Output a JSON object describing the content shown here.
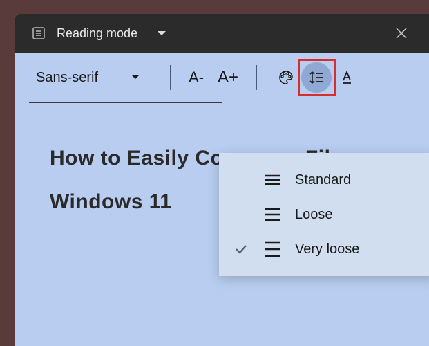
{
  "titlebar": {
    "mode_label": "Reading mode"
  },
  "toolbar": {
    "font_name": "Sans-serif",
    "font_dec": "A-",
    "font_inc": "A+"
  },
  "article": {
    "title": "How to Easily Compress Files on Windows 11"
  },
  "line_spacing_menu": {
    "items": [
      {
        "label": "Standard",
        "checked": false
      },
      {
        "label": "Loose",
        "checked": false
      },
      {
        "label": "Very loose",
        "checked": true
      }
    ]
  }
}
